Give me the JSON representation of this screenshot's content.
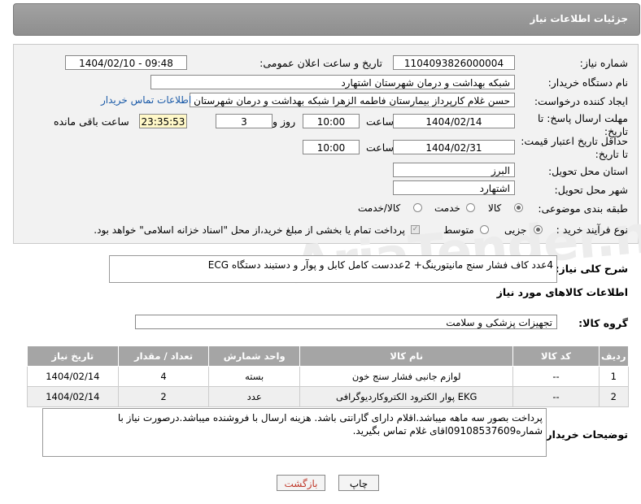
{
  "page": {
    "title": "جزئیات اطلاعات نیاز"
  },
  "form": {
    "need_number_label": "شماره نیاز:",
    "need_number": "1104093826000004",
    "announce_label": "تاریخ و ساعت اعلان عمومی:",
    "announce_value": "1404/02/10 - 09:48",
    "buyer_org_label": "نام دستگاه خریدار:",
    "buyer_org": "شبکه بهداشت و درمان شهرستان اشتهارد",
    "creator_label": "ایجاد کننده درخواست:",
    "creator": "حسن غلام کارپرداز بیمارستان فاطمه الزهرا شبکه بهداشت و درمان شهرستان ا",
    "contact_link": "اطلاعات تماس خریدار",
    "deadline_label": "مهلت ارسال پاسخ: تا تاریخ:",
    "deadline_date": "1404/02/14",
    "time_label": "ساعت",
    "deadline_time": "10:00",
    "day_and_label": "روز و",
    "days": "3",
    "remaining_time": "23:35:53",
    "remaining_label": "ساعت باقی مانده",
    "validity_label": "حداقل تاریخ اعتبار قیمت: تا تاریخ:",
    "validity_date": "1404/02/31",
    "validity_time": "10:00",
    "province_label": "استان محل تحویل:",
    "province": "البرز",
    "city_label": "شهر محل تحویل:",
    "city": "اشتهارد",
    "category_label": "طبقه بندی موضوعی:",
    "category_options": [
      "کالا",
      "خدمت",
      "کالا/خدمت"
    ],
    "process_label": "نوع فرآیند خرید :",
    "process_options": [
      "جزیی",
      "متوسط"
    ],
    "payment_note": "پرداخت تمام یا بخشی از مبلغ خرید،از محل \"اسناد خزانه اسلامی\" خواهد بود."
  },
  "description": {
    "label": "شرح کلی نیاز:",
    "text": "4عدد کاف فشار سنج مانیتورینگ+ 2عددست کامل کابل و پوآر و دستبند دستگاه ECG"
  },
  "goods": {
    "section_title": "اطلاعات کالاهای مورد نیاز",
    "group_label": "گروه کالا:",
    "group_value": "تجهیزات پزشکی و سلامت",
    "columns": [
      "ردیف",
      "کد کالا",
      "نام کالا",
      "واحد شمارش",
      "تعداد / مقدار",
      "تاریخ نیاز"
    ],
    "rows": [
      [
        "1",
        "--",
        "لوازم جانبی فشار سنج خون",
        "بسته",
        "4",
        "1404/02/14"
      ],
      [
        "2",
        "--",
        "پوار الکترود الکتروکاردیوگرافی EKG",
        "عدد",
        "2",
        "1404/02/14"
      ]
    ]
  },
  "buyer_notes": {
    "label": "توضیحات خریدار:",
    "text": "پرداخت بصور سه ماهه میباشد.اقلام دارای گارانتی باشد. هزینه ارسال با فروشنده میباشد.درصورت نیاز با شماره09108537609اقای غلام تماس بگیرید."
  },
  "buttons": {
    "print": "چاپ",
    "back": "بازگشت"
  },
  "watermark": "AriaTender.net"
}
